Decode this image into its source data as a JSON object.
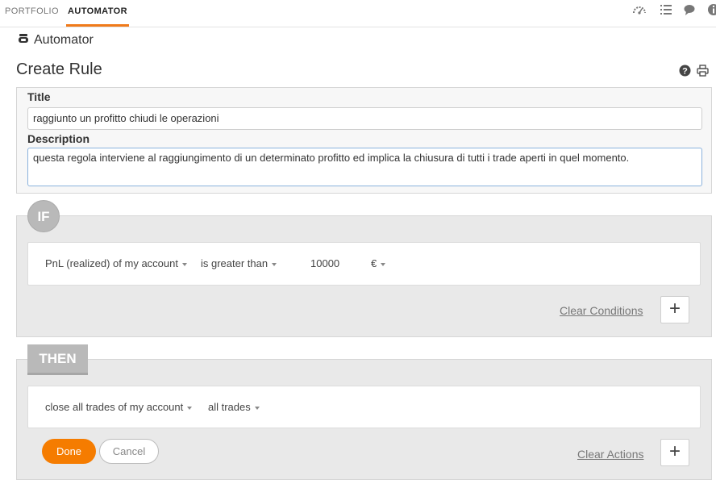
{
  "nav": {
    "tabs": [
      {
        "label": "PORTFOLIO"
      },
      {
        "label": "AUTOMATOR"
      }
    ],
    "icons": [
      "gauge-icon",
      "list-icon",
      "chat-icon",
      "info-icon"
    ]
  },
  "header": {
    "section": "Automator",
    "page_title": "Create Rule",
    "icons": [
      "help-icon",
      "print-icon"
    ]
  },
  "form": {
    "title_label": "Title",
    "title_value": "raggiunto un profitto chiudi le operazioni",
    "description_label": "Description",
    "description_value": "questa regola interviene al raggiungimento di un determinato profitto ed implica la chiusura di tutti i trade aperti in quel momento."
  },
  "if_block": {
    "badge": "IF",
    "condition": {
      "subject": "PnL (realized) of my account",
      "operator": "is greater than",
      "value": "10000",
      "currency": "€"
    },
    "clear_label": "Clear Conditions",
    "add_label": "+"
  },
  "then_block": {
    "badge": "THEN",
    "action": {
      "verb": "close all trades of my account",
      "target": "all trades"
    },
    "clear_label": "Clear Actions",
    "add_label": "+"
  },
  "buttons": {
    "done": "Done",
    "cancel": "Cancel"
  },
  "colors": {
    "accent": "#f57c00",
    "badge": "#b9b9b9",
    "panel": "#e9e9e9"
  }
}
